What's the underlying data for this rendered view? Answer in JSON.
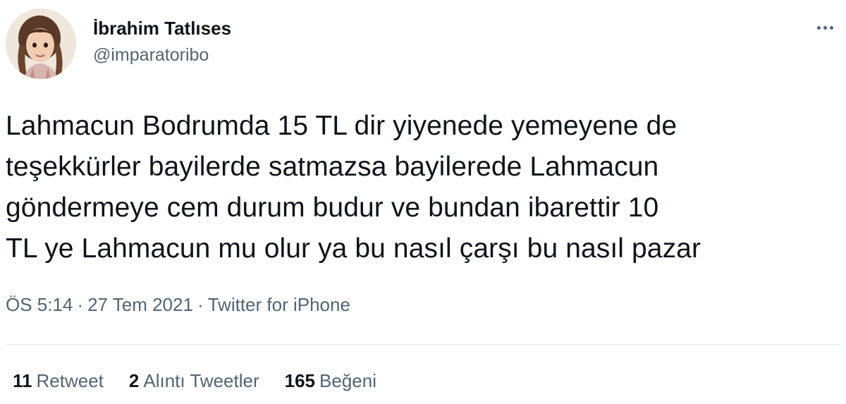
{
  "author": {
    "display_name": "İbrahim Tatlıses",
    "handle": "@imparatoribo",
    "avatar_icon": "user-avatar-photo"
  },
  "tweet": {
    "text": "Lahmacun Bodrumda 15 TL dir yiyenede yemeyene de\nteşekkürler bayilerde satmazsa bayilerede Lahmacun\ngöndermeye cem durum budur ve bundan ibarettir 10\nTL ye Lahmacun mu olur ya bu nasıl çarşı bu nasıl pazar",
    "time": "ÖS 5:14",
    "date": "27 Tem 2021",
    "source": "Twitter for iPhone",
    "separator": "·"
  },
  "stats": {
    "retweets": {
      "count": "11",
      "label": "Retweet"
    },
    "quotes": {
      "count": "2",
      "label": "Alıntı Tweetler"
    },
    "likes": {
      "count": "165",
      "label": "Beğeni"
    }
  },
  "colors": {
    "text_primary": "#0f1419",
    "text_secondary": "#536471",
    "divider": "#e1e8ed",
    "background": "#ffffff"
  },
  "icons": {
    "more": "more-horizontal-icon"
  }
}
